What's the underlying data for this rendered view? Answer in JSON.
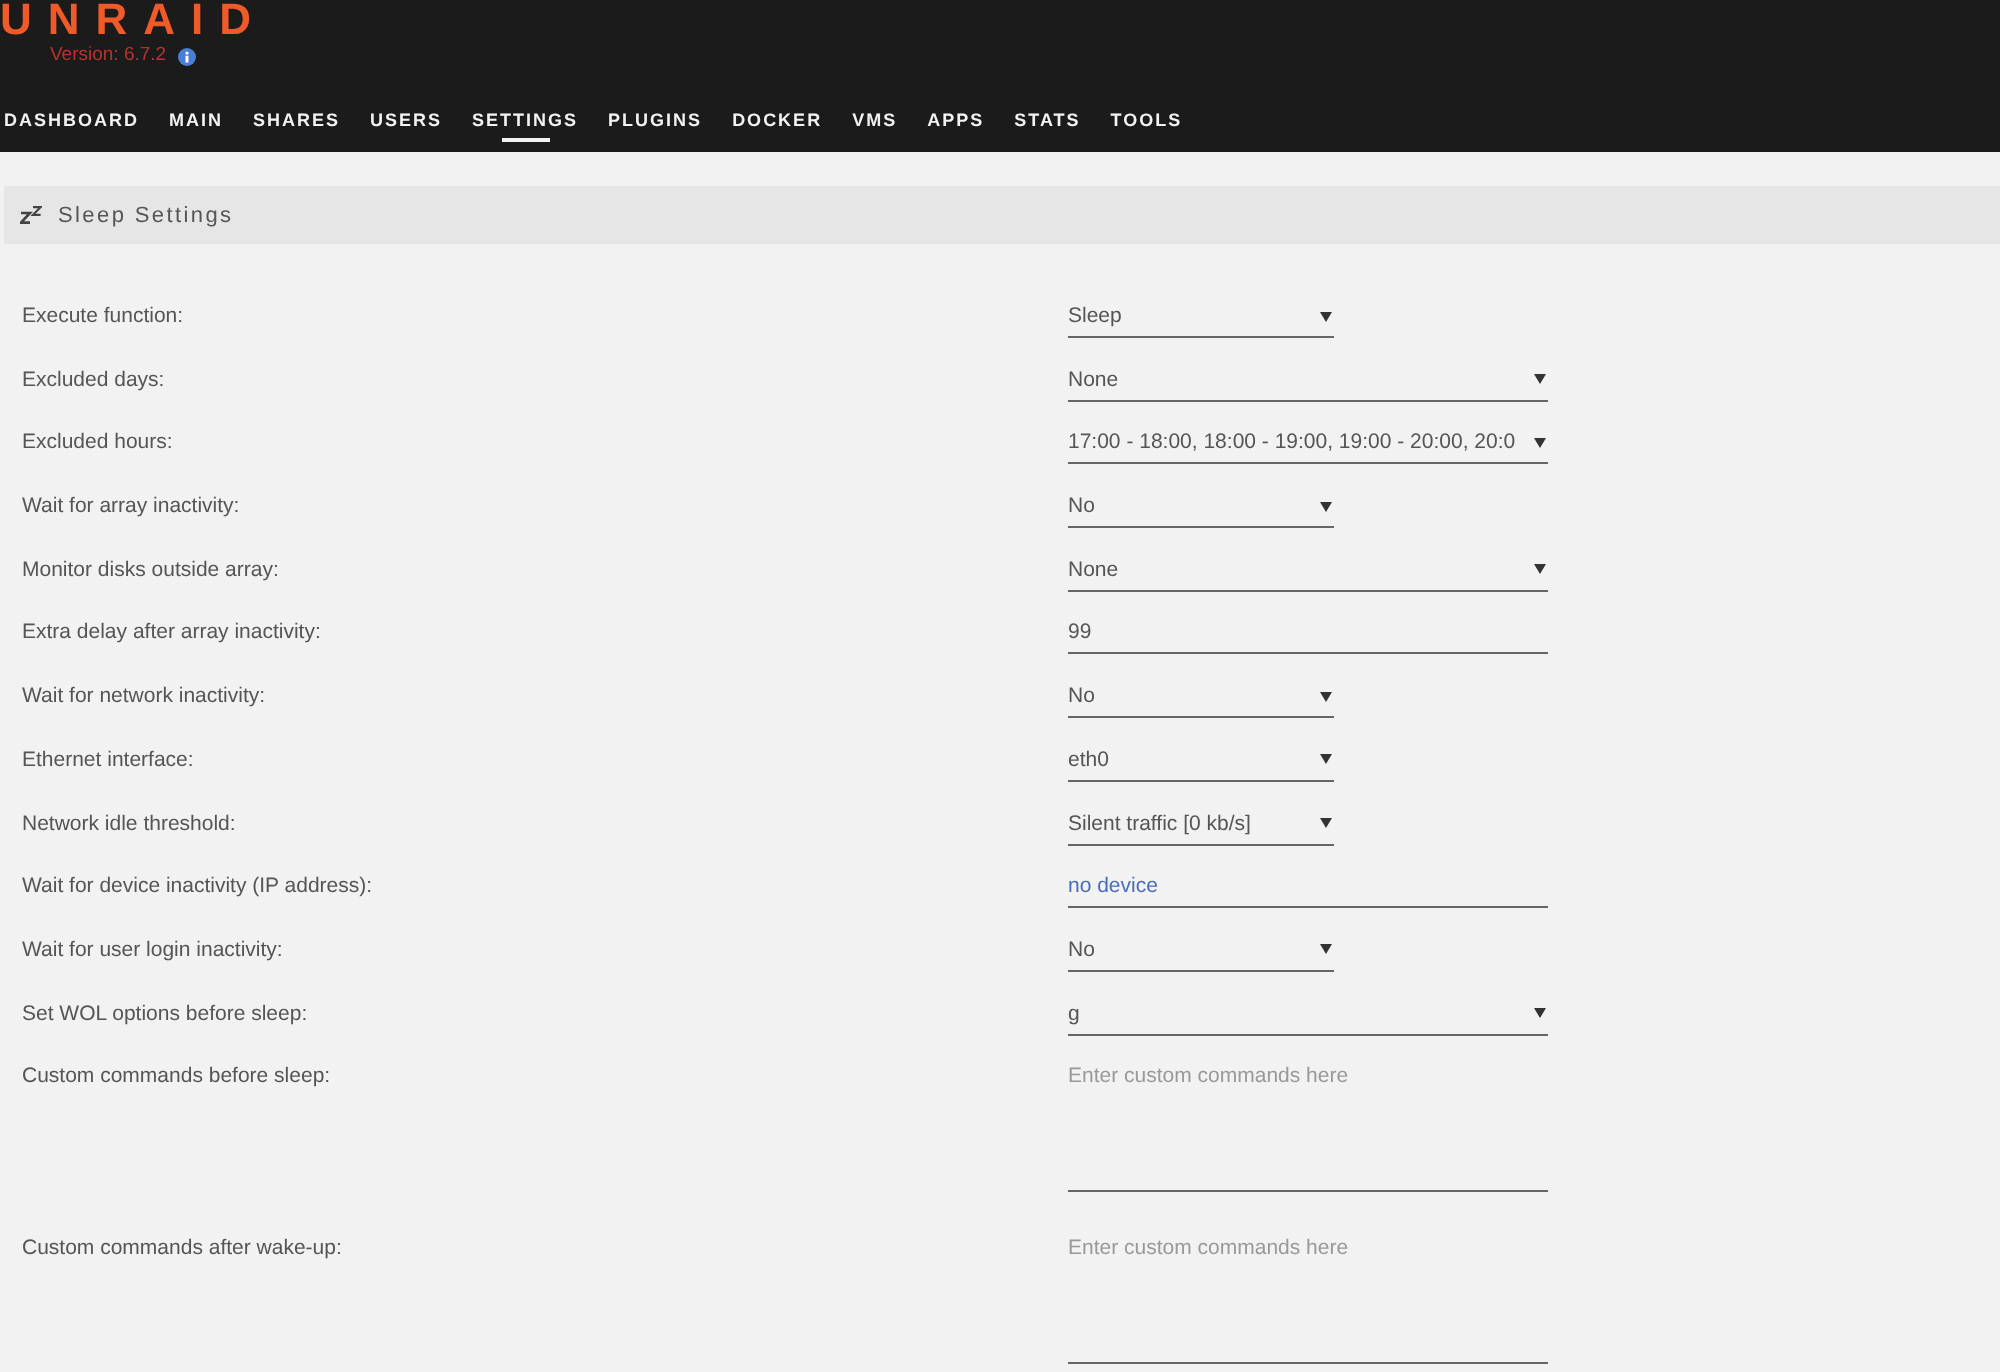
{
  "header": {
    "logo": "UNRAID",
    "version": "Version: 6.7.2"
  },
  "nav": [
    {
      "label": "DASHBOARD",
      "selected": false
    },
    {
      "label": "MAIN",
      "selected": false
    },
    {
      "label": "SHARES",
      "selected": false
    },
    {
      "label": "USERS",
      "selected": false
    },
    {
      "label": "SETTINGS",
      "selected": true
    },
    {
      "label": "PLUGINS",
      "selected": false
    },
    {
      "label": "DOCKER",
      "selected": false
    },
    {
      "label": "VMS",
      "selected": false
    },
    {
      "label": "APPS",
      "selected": false
    },
    {
      "label": "STATS",
      "selected": false
    },
    {
      "label": "TOOLS",
      "selected": false
    }
  ],
  "section": {
    "title": "Sleep Settings"
  },
  "settings": [
    {
      "label": "Execute function:",
      "kind": "select",
      "value": "Sleep"
    },
    {
      "label": "Excluded days:",
      "kind": "multiselect",
      "value": "None"
    },
    {
      "label": "Excluded hours:",
      "kind": "multiselect",
      "value": "17:00 - 18:00, 18:00 - 19:00, 19:00 - 20:00, 20:0"
    },
    {
      "label": "Wait for array inactivity:",
      "kind": "select",
      "value": "No"
    },
    {
      "label": "Monitor disks outside array:",
      "kind": "multiselect",
      "value": "None"
    },
    {
      "label": "Extra delay after array inactivity:",
      "kind": "text",
      "value": "99"
    },
    {
      "label": "Wait for network inactivity:",
      "kind": "select",
      "value": "No"
    },
    {
      "label": "Ethernet interface:",
      "kind": "select",
      "value": "eth0"
    },
    {
      "label": "Network idle threshold:",
      "kind": "select",
      "value": "Silent traffic [0 kb/s]"
    },
    {
      "label": "Wait for device inactivity (IP address):",
      "kind": "link",
      "value": "no device"
    },
    {
      "label": "Wait for user login inactivity:",
      "kind": "select",
      "value": "No"
    },
    {
      "label": "Set WOL options before sleep:",
      "kind": "multiselect",
      "value": "g"
    },
    {
      "label": "Custom commands before sleep:",
      "kind": "textarea",
      "placeholder": "Enter custom commands here"
    },
    {
      "label": "Custom commands after wake-up:",
      "kind": "textarea",
      "placeholder": "Enter custom commands here"
    }
  ]
}
